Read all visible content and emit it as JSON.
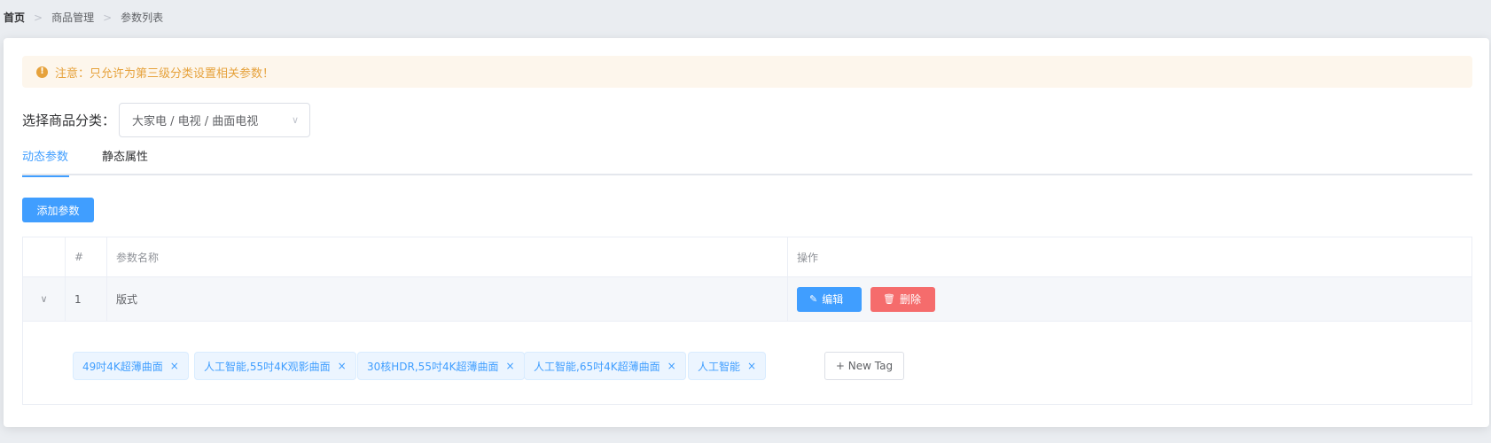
{
  "breadcrumb": {
    "items": [
      "首页",
      "商品管理",
      "参数列表"
    ]
  },
  "alert": {
    "text": "注意：只允许为第三级分类设置相关参数！",
    "icon": "warning-circle-icon"
  },
  "category": {
    "label": "选择商品分类：",
    "value": "大家电 / 电视 / 曲面电视"
  },
  "tabs": [
    {
      "label": "动态参数",
      "active": true
    },
    {
      "label": "静态属性",
      "active": false
    }
  ],
  "add_button": "添加参数",
  "table": {
    "headers": [
      "",
      "#",
      "参数名称",
      "操作"
    ],
    "rows": [
      {
        "index": "1",
        "name": "版式",
        "edit_label": "编辑",
        "delete_label": "删除",
        "tags": [
          "49吋4K超薄曲面",
          "人工智能,55吋4K观影曲面",
          "30核HDR,55吋4K超薄曲面",
          "人工智能,65吋4K超薄曲面",
          "人工智能"
        ]
      }
    ]
  },
  "new_tag_label": "+ New Tag",
  "colors": {
    "primary": "#409eff",
    "danger": "#f56c6c",
    "warning": "#e6a23c"
  }
}
